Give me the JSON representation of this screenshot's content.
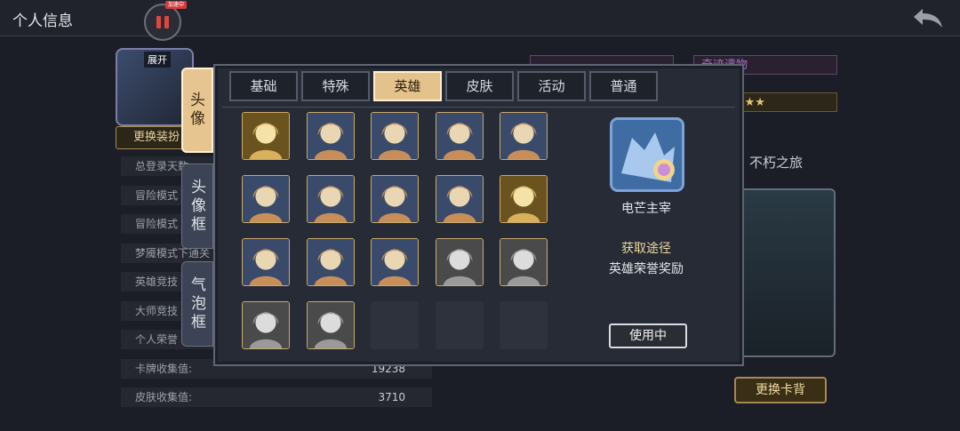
{
  "page": {
    "title": "个人信息",
    "speed_badge": "加速中"
  },
  "profile": {
    "expand_label": "展开",
    "change_outfit": "更换装扮",
    "stats": [
      {
        "label": "总登录天数",
        "value": ""
      },
      {
        "label": "冒险模式",
        "value": ""
      },
      {
        "label": "冒险模式",
        "value": ""
      },
      {
        "label": "梦魇模式下通关",
        "value": ""
      },
      {
        "label": "英雄竞技",
        "value": ""
      },
      {
        "label": "大师竞技",
        "value": ""
      },
      {
        "label": "个人荣誉",
        "value": ""
      },
      {
        "label": "卡牌收集值:",
        "value": "19238"
      },
      {
        "label": "皮肤收集值:",
        "value": "3710"
      }
    ]
  },
  "right_panel": {
    "banner_left": "",
    "banner_right": "奇迹遗物",
    "collector": "收藏家★★★",
    "journey": "不朽之旅",
    "change_cardback": "更换卡背"
  },
  "modal": {
    "side_tabs": [
      "头像",
      "头像框",
      "气泡框"
    ],
    "active_side_tab": 0,
    "tabs": [
      "基础",
      "特殊",
      "英雄",
      "皮肤",
      "活动",
      "普通"
    ],
    "active_tab": 2,
    "avatars": [
      {
        "name": "golden-helm-knight",
        "style": "gold"
      },
      {
        "name": "grey-cat",
        "style": "color"
      },
      {
        "name": "white-haired-elf",
        "style": "color"
      },
      {
        "name": "brown-haired-warrior",
        "style": "color"
      },
      {
        "name": "red-crested-warrior",
        "style": "color"
      },
      {
        "name": "purple-hat-rogue",
        "style": "color"
      },
      {
        "name": "goat-horned-beast",
        "style": "color"
      },
      {
        "name": "lion-mane-warrior",
        "style": "color"
      },
      {
        "name": "silver-haired-mage",
        "style": "color"
      },
      {
        "name": "horned-gold-armor",
        "style": "gold"
      },
      {
        "name": "hooded-gold-mask",
        "style": "color"
      },
      {
        "name": "blonde-warrior",
        "style": "color"
      },
      {
        "name": "shadow-demon",
        "style": "color"
      },
      {
        "name": "dark-haired-figure",
        "style": "grey"
      },
      {
        "name": "bald-elder",
        "style": "grey"
      },
      {
        "name": "silver-crown-queen",
        "style": "grey"
      },
      {
        "name": "hooded-dark-figure",
        "style": "grey"
      },
      {
        "name": "empty",
        "style": "empty"
      },
      {
        "name": "empty",
        "style": "empty"
      },
      {
        "name": "empty",
        "style": "empty"
      }
    ],
    "detail": {
      "avatar_name": "电芒主宰",
      "source_title": "获取途径",
      "source_desc": "英雄荣誉奖励",
      "use_button": "使用中"
    }
  },
  "colors": {
    "accent_gold": "#e3c28b",
    "frame_gold": "#c9a96c",
    "panel_bg": "#262b35"
  }
}
